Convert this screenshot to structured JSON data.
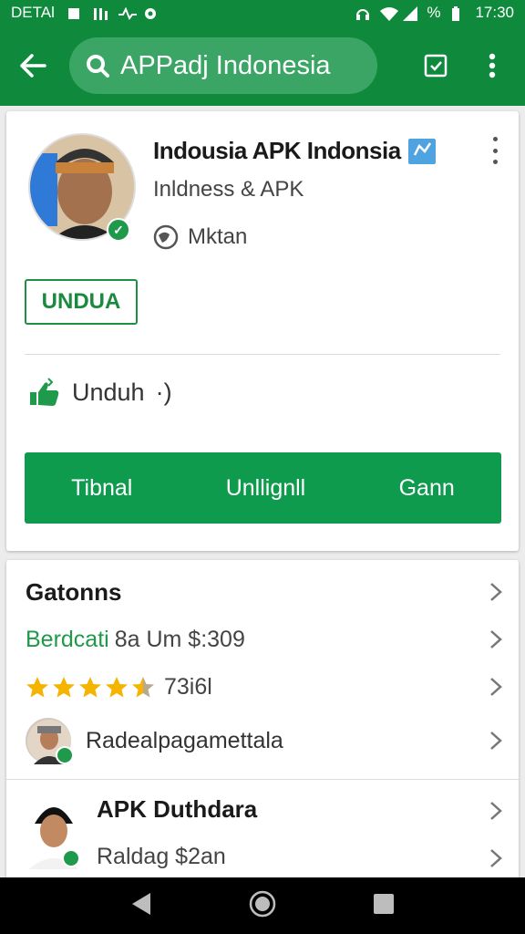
{
  "status_bar": {
    "carrier": "DETAl",
    "battery": "%",
    "time": "17:30"
  },
  "app_bar": {
    "search_text": "APPadj Indonesia"
  },
  "app_card": {
    "title": "Indousia APK Indonsia",
    "subtitle": "Inldness & APK",
    "location": "Mktan",
    "install_label": "UNDUA",
    "download_label": "Unduh",
    "download_suffix": "·)",
    "actions": [
      "Tibnal",
      "Unllignll",
      "Gann"
    ]
  },
  "list_card": {
    "header": "Gatonns",
    "price_row": {
      "green_text": "Berdcati",
      "rest_text": "8a Um $:309"
    },
    "rating": {
      "value": 4.5,
      "max": 5,
      "count_text": "73i6l"
    },
    "reviewer_name": "Radealpagamettala",
    "publisher": {
      "name": "APK Duthdara",
      "detail": "Raldag $2an"
    }
  },
  "colors": {
    "primary": "#0f8a3c",
    "accent": "#1f9a4a",
    "star": "#f4b400"
  }
}
